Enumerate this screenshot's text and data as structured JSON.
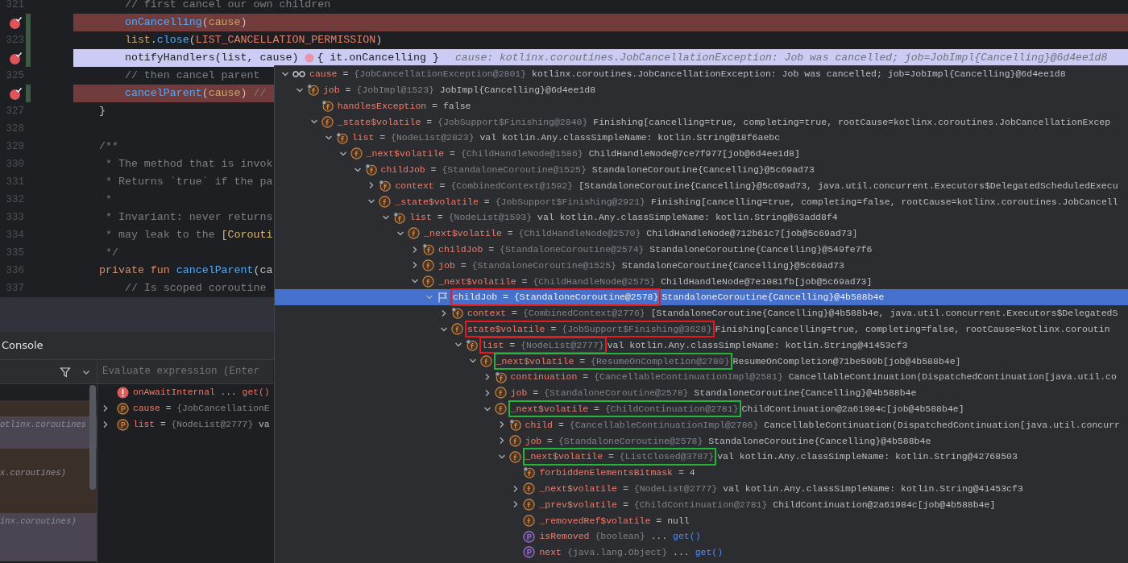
{
  "editor": {
    "lines": [
      {
        "number": "321",
        "breakpoint": false,
        "changed": false,
        "current": false,
        "tokens": [
          {
            "kind": "comment",
            "text": "    // first cancel our own children"
          }
        ]
      },
      {
        "breakpoint": true,
        "changed": true,
        "current": false,
        "tokens": [
          {
            "kind": "call",
            "text": "    onCancelling"
          },
          {
            "kind": "plain",
            "text": "("
          },
          {
            "kind": "param",
            "text": "cause"
          },
          {
            "kind": "plain",
            "text": ")"
          }
        ]
      },
      {
        "number": "323",
        "breakpoint": false,
        "changed": true,
        "current": false,
        "tokens": [
          {
            "kind": "param",
            "text": "    list"
          },
          {
            "kind": "plain",
            "text": "."
          },
          {
            "kind": "call",
            "text": "close"
          },
          {
            "kind": "plain",
            "text": "("
          },
          {
            "kind": "const",
            "text": "LIST_CANCELLATION_PERMISSION"
          },
          {
            "kind": "plain",
            "text": ")"
          }
        ]
      },
      {
        "breakpoint": true,
        "changed": true,
        "current": true,
        "tokens": [
          {
            "kind": "plain",
            "text": "    notifyHandlers(list, cause)"
          },
          {
            "kind": "lambda_dot"
          },
          {
            "kind": "plain",
            "text": "{ it.onCancelling }"
          },
          {
            "kind": "hint",
            "text": "cause: kotlinx.coroutines.JobCancellationException: Job was cancelled; job=JobImpl{Cancelling}@6d4ee1d8"
          }
        ]
      },
      {
        "number": "325",
        "breakpoint": false,
        "changed": false,
        "current": false,
        "tokens": [
          {
            "kind": "comment",
            "text": "    // then cancel parent"
          }
        ]
      },
      {
        "breakpoint": true,
        "changed": true,
        "current": false,
        "tokens": [
          {
            "kind": "call",
            "text": "    cancelParent"
          },
          {
            "kind": "plain",
            "text": "("
          },
          {
            "kind": "param",
            "text": "cause"
          },
          {
            "kind": "plain",
            "text": ")"
          },
          {
            "kind": "comment",
            "text": " //"
          }
        ]
      },
      {
        "number": "327",
        "breakpoint": false,
        "changed": false,
        "current": false,
        "tokens": [
          {
            "kind": "plain",
            "text": "}"
          }
        ]
      },
      {
        "number": "328",
        "breakpoint": false,
        "changed": false,
        "current": false
      },
      {
        "number": "329",
        "breakpoint": false,
        "changed": false,
        "current": false,
        "tokens": [
          {
            "kind": "comment",
            "text": "/**"
          }
        ]
      },
      {
        "number": "330",
        "breakpoint": false,
        "changed": false,
        "current": false,
        "tokens": [
          {
            "kind": "comment",
            "text": " * The method that is invok"
          }
        ]
      },
      {
        "number": "331",
        "breakpoint": false,
        "changed": false,
        "current": false,
        "tokens": [
          {
            "kind": "comment",
            "text": " * Returns `true` if the pa"
          }
        ]
      },
      {
        "number": "332",
        "breakpoint": false,
        "changed": false,
        "current": false,
        "tokens": [
          {
            "kind": "comment",
            "text": " *"
          }
        ]
      },
      {
        "number": "333",
        "breakpoint": false,
        "changed": false,
        "current": false,
        "tokens": [
          {
            "kind": "comment",
            "text": " * Invariant: never returns"
          }
        ]
      },
      {
        "number": "334",
        "breakpoint": false,
        "changed": false,
        "current": false,
        "tokens": [
          {
            "kind": "comment",
            "text": " * may leak to the "
          },
          {
            "kind": "doc_link",
            "text": "[Corouti"
          }
        ]
      },
      {
        "number": "335",
        "breakpoint": false,
        "changed": false,
        "current": false,
        "tokens": [
          {
            "kind": "comment",
            "text": " */"
          }
        ]
      },
      {
        "number": "336",
        "breakpoint": false,
        "changed": false,
        "current": false,
        "tokens": [
          {
            "kind": "keyword",
            "text": "private fun "
          },
          {
            "kind": "call",
            "text": "cancelParent"
          },
          {
            "kind": "plain",
            "text": "(ca"
          }
        ]
      },
      {
        "number": "337",
        "breakpoint": false,
        "changed": false,
        "current": false,
        "tokens": [
          {
            "kind": "comment",
            "text": "    // Is scoped coroutine"
          }
        ]
      }
    ]
  },
  "debug_panel": {
    "tab": "Console",
    "evaluate_placeholder": "Evaluate expression (Enter",
    "frames": [
      {
        "color": "#3b2f29"
      },
      {
        "color": "#4a4551",
        "text": "otlinx.coroutines"
      },
      {
        "color": "#4a4551"
      },
      {
        "color": "#3b2f29"
      },
      {
        "color": "#3b2f29",
        "text": "x.coroutines)"
      },
      {
        "color": "#3b2f29"
      },
      {
        "color": "#3b2f29"
      },
      {
        "color": "#4a4551",
        "text": "inx.coroutines)"
      },
      {
        "color": "#4a4551"
      },
      {
        "color": "#4a4551"
      }
    ],
    "results": [
      {
        "kind": "error",
        "name": "onAwaitInternal",
        "value": "...",
        "link": "get()"
      },
      {
        "kind": "property",
        "expanded": false,
        "name": "cause",
        "op": "=",
        "type": "{JobCancellationE"
      },
      {
        "kind": "property",
        "expanded": false,
        "name": "list",
        "op": "=",
        "type": "{NodeList@2777}",
        "value": "va"
      }
    ]
  },
  "variables_popup": {
    "items": [
      {
        "kind": "watch",
        "name": "cause",
        "op": "=",
        "type": "{JobCancellationException@2801}",
        "value": "kotlinx.coroutines.JobCancellationException: Job was cancelled; job=JobImpl{Cancelling}@6d4ee1d8",
        "expanded": true,
        "selected": false,
        "children": [
          {
            "kind": "pinned_field",
            "name": "job",
            "op": "=",
            "type": "{JobImpl@1523}",
            "value": "JobImpl{Cancelling}@6d4ee1d8",
            "expanded": true,
            "selected": false,
            "children": [
              {
                "kind": "pinned_field",
                "name": "handlesException",
                "op": "=",
                "value": "false",
                "selected": false
              },
              {
                "kind": "field",
                "name": "_state$volatile",
                "op": "=",
                "type": "{JobSupport$Finishing@2840}",
                "value": "Finishing[cancelling=true, completing=true, rootCause=kotlinx.coroutines.JobCancellationExcep",
                "expanded": true,
                "selected": false,
                "children": [
                  {
                    "kind": "pinned_field",
                    "name": "list",
                    "op": "=",
                    "type": "{NodeList@2823}",
                    "value": "val kotlin.Any.classSimpleName: kotlin.String@18f6aebc",
                    "expanded": true,
                    "selected": false,
                    "children": [
                      {
                        "kind": "field",
                        "name": "_next$volatile",
                        "op": "=",
                        "type": "{ChildHandleNode@1586}",
                        "value": "ChildHandleNode@7ce7f977[job@6d4ee1d8]",
                        "expanded": true,
                        "selected": false,
                        "children": [
                          {
                            "kind": "pinned_field",
                            "name": "childJob",
                            "op": "=",
                            "type": "{StandaloneCoroutine@1525}",
                            "value": "StandaloneCoroutine{Cancelling}@5c69ad73",
                            "expanded": true,
                            "selected": false,
                            "children": [
                              {
                                "kind": "pinned_field",
                                "name": "context",
                                "op": "=",
                                "type": "{CombinedContext@1592}",
                                "value": "[StandaloneCoroutine{Cancelling}@5c69ad73, java.util.concurrent.Executors$DelegatedScheduledExecu",
                                "expanded": false,
                                "selected": false
                              },
                              {
                                "kind": "field",
                                "name": "_state$volatile",
                                "op": "=",
                                "type": "{JobSupport$Finishing@2921}",
                                "value": "Finishing[cancelling=true, completing=false, rootCause=kotlinx.coroutines.JobCancell",
                                "expanded": true,
                                "selected": false,
                                "children": [
                                  {
                                    "kind": "pinned_field",
                                    "name": "list",
                                    "op": "=",
                                    "type": "{NodeList@1593}",
                                    "value": "val kotlin.Any.classSimpleName: kotlin.String@63add8f4",
                                    "expanded": true,
                                    "selected": false,
                                    "children": [
                                      {
                                        "kind": "field",
                                        "name": "_next$volatile",
                                        "op": "=",
                                        "type": "{ChildHandleNode@2570}",
                                        "value": "ChildHandleNode@712b61c7[job@5c69ad73]",
                                        "expanded": true,
                                        "selected": false,
                                        "children": [
                                          {
                                            "kind": "pinned_field",
                                            "name": "childJob",
                                            "op": "=",
                                            "type": "{StandaloneCoroutine@2574}",
                                            "value": "StandaloneCoroutine{Cancelling}@549fe7f6",
                                            "expanded": false,
                                            "selected": false
                                          },
                                          {
                                            "kind": "field",
                                            "name": "job",
                                            "op": "=",
                                            "type": "{StandaloneCoroutine@1525}",
                                            "value": "StandaloneCoroutine{Cancelling}@5c69ad73",
                                            "expanded": false,
                                            "selected": false
                                          },
                                          {
                                            "kind": "field",
                                            "name": "_next$volatile",
                                            "op": "=",
                                            "type": "{ChildHandleNode@2575}",
                                            "value": "ChildHandleNode@7e1081fb[job@5c69ad73]",
                                            "expanded": true,
                                            "selected": false,
                                            "children": [
                                              {
                                                "kind": "flag",
                                                "name": "childJob",
                                                "op": "=",
                                                "type": "{StandaloneCoroutine@2578}",
                                                "value": "StandaloneCoroutine{Cancelling}@4b588b4e",
                                                "expanded": true,
                                                "selected": true,
                                                "color": "#e5191e",
                                                "children": [
                                                  {
                                                    "kind": "pinned_field",
                                                    "name": "context",
                                                    "op": "=",
                                                    "type": "{CombinedContext@2776}",
                                                    "value": "[StandaloneCoroutine{Cancelling}@4b588b4e, java.util.concurrent.Executors$DelegatedS",
                                                    "expanded": false,
                                                    "selected": false
                                                  },
                                                  {
                                                    "kind": "field",
                                                    "name": "state$volatile",
                                                    "op": "=",
                                                    "type": "{JobSupport$Finishing@3628}",
                                                    "value": "Finishing[cancelling=true, completing=false, rootCause=kotlinx.coroutin",
                                                    "expanded": true,
                                                    "selected": false,
                                                    "color": "#e5191e",
                                                    "children": [
                                                      {
                                                        "kind": "pinned_field",
                                                        "name": "list",
                                                        "op": "=",
                                                        "type": "{NodeList@2777}",
                                                        "value": "val kotlin.Any.classSimpleName: kotlin.String@41453cf3",
                                                        "expanded": true,
                                                        "selected": false,
                                                        "color": "#e5191e",
                                                        "children": [
                                                          {
                                                            "kind": "field",
                                                            "name": "_next$volatile",
                                                            "op": "=",
                                                            "type": "{ResumeOnCompletion@2780}",
                                                            "value": "ResumeOnCompletion@71be509b[job@4b588b4e]",
                                                            "expanded": true,
                                                            "selected": false,
                                                            "color": "#27b33a",
                                                            "children": [
                                                              {
                                                                "kind": "pinned_field",
                                                                "name": "continuation",
                                                                "op": "=",
                                                                "type": "{CancellableContinuationImpl@2581}",
                                                                "value": "CancellableContinuation(DispatchedContinuation[java.util.co",
                                                                "expanded": false,
                                                                "selected": false
                                                              },
                                                              {
                                                                "kind": "field",
                                                                "name": "job",
                                                                "op": "=",
                                                                "type": "{StandaloneCoroutine@2578}",
                                                                "value": "StandaloneCoroutine{Cancelling}@4b588b4e",
                                                                "expanded": false,
                                                                "selected": false
                                                              },
                                                              {
                                                                "kind": "field",
                                                                "name": "_next$volatile",
                                                                "op": "=",
                                                                "type": "{ChildContinuation@2781}",
                                                                "value": "ChildContinuation@2a61984c[job@4b588b4e]",
                                                                "expanded": true,
                                                                "selected": false,
                                                                "color": "#27b33a",
                                                                "children": [
                                                                  {
                                                                    "kind": "pinned_field",
                                                                    "name": "child",
                                                                    "op": "=",
                                                                    "type": "{CancellableContinuationImpl@2786}",
                                                                    "value": "CancellableContinuation(DispatchedContinuation[java.util.concurr",
                                                                    "expanded": false,
                                                                    "selected": false
                                                                  },
                                                                  {
                                                                    "kind": "field",
                                                                    "name": "job",
                                                                    "op": "=",
                                                                    "type": "{StandaloneCoroutine@2578}",
                                                                    "value": "StandaloneCoroutine{Cancelling}@4b588b4e",
                                                                    "expanded": false,
                                                                    "selected": false
                                                                  },
                                                                  {
                                                                    "kind": "field",
                                                                    "name": "_next$volatile",
                                                                    "op": "=",
                                                                    "type": "{ListClosed@3787}",
                                                                    "value": "val kotlin.Any.classSimpleName: kotlin.String@42768503",
                                                                    "expanded": true,
                                                                    "selected": false,
                                                                    "color": "#27b33a",
                                                                    "children": [
                                                                      {
                                                                        "kind": "pinned_field",
                                                                        "name": "forbiddenElementsBitmask",
                                                                        "op": "=",
                                                                        "value": "4",
                                                                        "selected": false
                                                                      },
                                                                      {
                                                                        "kind": "field",
                                                                        "name": "_next$volatile",
                                                                        "op": "=",
                                                                        "type": "{NodeList@2777}",
                                                                        "value": "val kotlin.Any.classSimpleName: kotlin.String@41453cf3",
                                                                        "expanded": false,
                                                                        "selected": false
                                                                      },
                                                                      {
                                                                        "kind": "field",
                                                                        "name": "_prev$volatile",
                                                                        "op": "=",
                                                                        "type": "{ChildContinuation@2781}",
                                                                        "value": "ChildContinuation@2a61984c[job@4b588b4e]",
                                                                        "expanded": false,
                                                                        "selected": false
                                                                      },
                                                                      {
                                                                        "kind": "field",
                                                                        "name": "_removedRef$volatile",
                                                                        "op": "=",
                                                                        "value": "null",
                                                                        "selected": false
                                                                      },
                                                                      {
                                                                        "kind": "property",
                                                                        "name": "isRemoved",
                                                                        "type": "{boolean}",
                                                                        "value": "...",
                                                                        "link": "get()",
                                                                        "selected": false
                                                                      },
                                                                      {
                                                                        "kind": "property",
                                                                        "name": "next",
                                                                        "type": "{java.lang.Object}",
                                                                        "value": "...",
                                                                        "link": "get()",
                                                                        "selected": false
                                                                      }
                                                                    ]
                                                                  }
                                                                ]
                                                              }
                                                            ]
                                                          }
                                                        ]
                                                      }
                                                    ]
                                                  }
                                                ]
                                              }
                                            ]
                                          }
                                        ]
                                      }
                                    ]
                                  }
                                ]
                              }
                            ]
                          }
                        ]
                      }
                    ]
                  }
                ]
              }
            ]
          }
        ]
      }
    ]
  }
}
